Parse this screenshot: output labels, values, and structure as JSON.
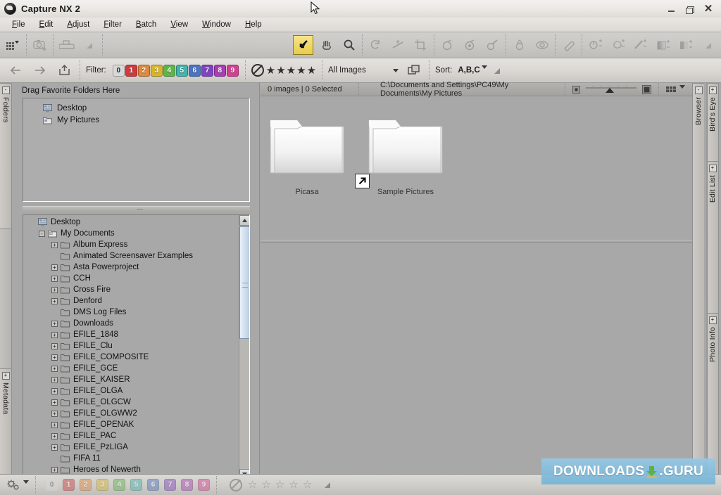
{
  "window": {
    "title": "Capture NX 2",
    "logo_icon": "nikon-nx-logo-icon",
    "minimize_label": "minimize-icon",
    "restore_label": "restore-icon",
    "close_label": "close-icon"
  },
  "menubar": {
    "items": [
      {
        "label": "File"
      },
      {
        "label": "Edit"
      },
      {
        "label": "Adjust"
      },
      {
        "label": "Filter"
      },
      {
        "label": "Batch"
      },
      {
        "label": "View"
      },
      {
        "label": "Window"
      },
      {
        "label": "Help"
      }
    ]
  },
  "toolbar": {
    "groups": [
      {
        "icons": [
          {
            "name": "workspace-grid-icon",
            "enabled": true,
            "dropdown": true
          }
        ]
      },
      {
        "icons": [
          {
            "name": "camera-transfer-icon",
            "enabled": false
          }
        ]
      },
      {
        "icons": [
          {
            "name": "print-icon",
            "enabled": false
          },
          {
            "name": "resize-grip-icon",
            "enabled": false
          }
        ]
      },
      {
        "icons": [
          {
            "name": "direct-select-arrow-icon",
            "enabled": true,
            "selected": true
          },
          {
            "name": "hand-pan-icon",
            "enabled": true
          },
          {
            "name": "zoom-magnifier-icon",
            "enabled": true
          }
        ]
      },
      {
        "icons": [
          {
            "name": "rotate-icon",
            "enabled": false
          },
          {
            "name": "straighten-icon",
            "enabled": false
          },
          {
            "name": "crop-icon",
            "enabled": false
          }
        ]
      },
      {
        "icons": [
          {
            "name": "black-control-point-icon",
            "enabled": false
          },
          {
            "name": "white-control-point-icon",
            "enabled": false
          },
          {
            "name": "neutral-control-point-icon",
            "enabled": false
          }
        ]
      },
      {
        "icons": [
          {
            "name": "color-control-point-icon",
            "enabled": false
          },
          {
            "name": "red-eye-control-point-icon",
            "enabled": false
          }
        ]
      },
      {
        "icons": [
          {
            "name": "auto-retouch-brush-icon",
            "enabled": false
          }
        ]
      },
      {
        "icons": [
          {
            "name": "selection-brush-plus-icon",
            "enabled": false
          },
          {
            "name": "lasso-plus-icon",
            "enabled": false
          },
          {
            "name": "selection-line-plus-icon",
            "enabled": false
          },
          {
            "name": "gradient-plus-icon",
            "enabled": false
          },
          {
            "name": "fill-remove-plus-icon",
            "enabled": false
          },
          {
            "name": "resize-grip-icon",
            "enabled": false
          }
        ]
      }
    ]
  },
  "filterbar": {
    "back_icon": "back-arrow-icon",
    "forward_icon": "forward-arrow-icon",
    "open_icon": "open-in-editor-icon",
    "filter_label": "Filter:",
    "labels": [
      {
        "text": "0",
        "color": "#d8d8d8"
      },
      {
        "text": "1",
        "color": "#cf3a3f"
      },
      {
        "text": "2",
        "color": "#e2883c"
      },
      {
        "text": "3",
        "color": "#d8b429"
      },
      {
        "text": "4",
        "color": "#5fb54a"
      },
      {
        "text": "5",
        "color": "#45b3ae"
      },
      {
        "text": "6",
        "color": "#4a74c4"
      },
      {
        "text": "7",
        "color": "#7e45c0"
      },
      {
        "text": "8",
        "color": "#a93fb4"
      },
      {
        "text": "9",
        "color": "#d63f92"
      }
    ],
    "rating_no_rating_icon": "no-rating-icon",
    "rating_stars": 5,
    "view_filter": "All Images",
    "view_filter_dropdown_icon": "chevron-down-icon",
    "stack_icon": "stack-view-icon",
    "sort_label": "Sort:",
    "sort_value": "A,B,C",
    "sort_dropdown_icon": "chevron-down-icon"
  },
  "left_rail": {
    "tabs": [
      {
        "label": "Folders",
        "state": "-"
      },
      {
        "label": "Metadata",
        "state": "+"
      }
    ]
  },
  "right_rail": {
    "tabs": [
      {
        "label": "Browser",
        "state": "-"
      },
      {
        "label": "Bird's Eye",
        "state": "+"
      },
      {
        "label": "Edit List",
        "state": "+"
      },
      {
        "label": "Photo Info",
        "state": "+"
      }
    ]
  },
  "favorites": {
    "header": "Drag Favorite Folders Here",
    "items": [
      {
        "label": "Desktop",
        "icon": "desktop-icon"
      },
      {
        "label": "My Pictures",
        "icon": "pictures-folder-icon"
      }
    ]
  },
  "tree": {
    "items": [
      {
        "label": "Desktop",
        "indent": 0,
        "expander": "none",
        "icon": "desktop-icon"
      },
      {
        "label": "My Documents",
        "indent": 1,
        "expander": "-",
        "icon": "my-documents-icon"
      },
      {
        "label": "Album Express",
        "indent": 2,
        "expander": "+",
        "icon": "folder-icon"
      },
      {
        "label": "Animated Screensaver Examples",
        "indent": 2,
        "expander": "none",
        "icon": "folder-icon"
      },
      {
        "label": "Asta Powerproject",
        "indent": 2,
        "expander": "+",
        "icon": "folder-icon"
      },
      {
        "label": "CCH",
        "indent": 2,
        "expander": "+",
        "icon": "folder-icon"
      },
      {
        "label": "Cross Fire",
        "indent": 2,
        "expander": "+",
        "icon": "folder-icon"
      },
      {
        "label": "Denford",
        "indent": 2,
        "expander": "+",
        "icon": "folder-icon"
      },
      {
        "label": "DMS Log Files",
        "indent": 2,
        "expander": "none",
        "icon": "folder-icon"
      },
      {
        "label": "Downloads",
        "indent": 2,
        "expander": "+",
        "icon": "folder-icon"
      },
      {
        "label": "EFILE_1848",
        "indent": 2,
        "expander": "+",
        "icon": "folder-icon"
      },
      {
        "label": "EFILE_Clu",
        "indent": 2,
        "expander": "+",
        "icon": "folder-icon"
      },
      {
        "label": "EFILE_COMPOSITE",
        "indent": 2,
        "expander": "+",
        "icon": "folder-icon"
      },
      {
        "label": "EFILE_GCE",
        "indent": 2,
        "expander": "+",
        "icon": "folder-icon"
      },
      {
        "label": "EFILE_KAISER",
        "indent": 2,
        "expander": "+",
        "icon": "folder-icon"
      },
      {
        "label": "EFILE_OLGA",
        "indent": 2,
        "expander": "+",
        "icon": "folder-icon"
      },
      {
        "label": "EFILE_OLGCW",
        "indent": 2,
        "expander": "+",
        "icon": "folder-icon"
      },
      {
        "label": "EFILE_OLGWW2",
        "indent": 2,
        "expander": "+",
        "icon": "folder-icon"
      },
      {
        "label": "EFILE_OPENAK",
        "indent": 2,
        "expander": "+",
        "icon": "folder-icon"
      },
      {
        "label": "EFILE_PAC",
        "indent": 2,
        "expander": "+",
        "icon": "folder-icon"
      },
      {
        "label": "EFILE_PzLIGA",
        "indent": 2,
        "expander": "+",
        "icon": "folder-icon"
      },
      {
        "label": "FIFA 11",
        "indent": 2,
        "expander": "none",
        "icon": "folder-icon"
      },
      {
        "label": "Heroes of Newerth",
        "indent": 2,
        "expander": "+",
        "icon": "folder-icon"
      }
    ]
  },
  "browser": {
    "status": "0 images | 0 Selected",
    "path": "C:\\Documents and Settings\\PC49\\My Documents\\My Pictures",
    "thumb_small_icon": "small-thumbnail-icon",
    "thumb_large_icon": "large-thumbnail-icon",
    "grid_view_icon": "grid-view-icon",
    "grid_view_dropdown_icon": "chevron-down-icon",
    "items": [
      {
        "label": "Picasa",
        "icon": "folder-thumbnail-icon",
        "shortcut": false
      },
      {
        "label": "Sample Pictures",
        "icon": "folder-thumbnail-icon",
        "shortcut": true,
        "shortcut_icon": "shortcut-arrow-icon"
      }
    ]
  },
  "bottombar": {
    "settings_icon": "gears-settings-icon",
    "settings_dropdown_icon": "chevron-down-icon",
    "labels": [
      {
        "text": "0",
        "color": "#d8d8d8"
      },
      {
        "text": "1",
        "color": "#cf3a3f"
      },
      {
        "text": "2",
        "color": "#e2883c"
      },
      {
        "text": "3",
        "color": "#d8b429"
      },
      {
        "text": "4",
        "color": "#5fb54a"
      },
      {
        "text": "5",
        "color": "#45b3ae"
      },
      {
        "text": "6",
        "color": "#4a74c4"
      },
      {
        "text": "7",
        "color": "#7e45c0"
      },
      {
        "text": "8",
        "color": "#a93fb4"
      },
      {
        "text": "9",
        "color": "#d63f92"
      }
    ],
    "no_rating_icon": "no-rating-icon",
    "rating_stars": 5,
    "resize_grip_icon": "resize-grip-icon"
  },
  "watermark": {
    "text_left": "DOWNLOADS",
    "text_right": ".GURU",
    "icon": "download-arrow-icon"
  },
  "cursor": {
    "icon": "mouse-pointer-icon"
  }
}
